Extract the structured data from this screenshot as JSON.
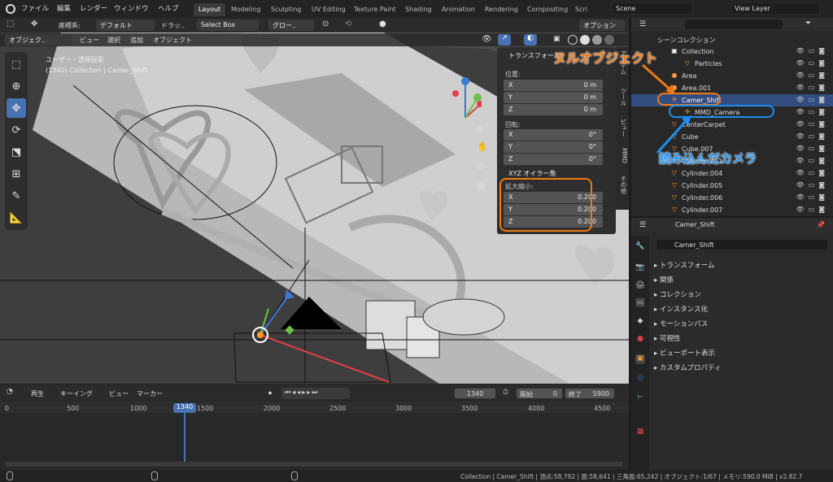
{
  "topbar": {
    "menus": [
      "ファイル",
      "編集",
      "レンダー",
      "ウィンドウ",
      "ヘルプ"
    ],
    "tabs": [
      "Layout",
      "Modeling",
      "Sculpting",
      "UV Editing",
      "Texture Paint",
      "Shading",
      "Animation",
      "Rendering",
      "Compositing",
      "Scri"
    ],
    "scene": "Scene",
    "view_layer": "View Layer"
  },
  "tool_header": {
    "coord_label": "座標系:",
    "coord_value": "デフォルト",
    "drag_label": "ドラッ..",
    "drag_value": "Select Box",
    "transform_pivot": "グロー..",
    "options": "オプション"
  },
  "viewport_header": {
    "mode": "オブジェク..",
    "view": "ビュー",
    "select": "選択",
    "add": "追加",
    "object": "オブジェクト"
  },
  "viewport": {
    "title": "ユーザー・透視投影",
    "subtitle": "(1340) Collection | Camer_Shift"
  },
  "npanel": {
    "title": "トランスフォーム",
    "location_label": "位置:",
    "location": [
      {
        "k": "X",
        "v": "0 m"
      },
      {
        "k": "Y",
        "v": "0 m"
      },
      {
        "k": "Z",
        "v": "0 m"
      }
    ],
    "rotation_label": "回転:",
    "rotation": [
      {
        "k": "X",
        "v": "0°"
      },
      {
        "k": "Y",
        "v": "0°"
      },
      {
        "k": "Z",
        "v": "0°"
      }
    ],
    "rotation_mode": "XYZ オイラー角",
    "scale_label": "拡大縮小:",
    "scale": [
      {
        "k": "X",
        "v": "0.200"
      },
      {
        "k": "Y",
        "v": "0.200"
      },
      {
        "k": "Z",
        "v": "0.200"
      }
    ],
    "tabs": [
      "アイテム",
      "ツール",
      "ビュー",
      "MMD",
      "その他"
    ]
  },
  "outliner": {
    "root": "シーンコレクション",
    "rows": [
      {
        "name": "Collection",
        "icon": "collection"
      },
      {
        "name": "Particles",
        "icon": "mesh"
      },
      {
        "name": "Area",
        "icon": "light"
      },
      {
        "name": "Area.001",
        "icon": "light"
      },
      {
        "name": "Camer_Shift",
        "icon": "empty"
      },
      {
        "name": "MMD_Camera",
        "icon": "camera"
      },
      {
        "name": "CenterCarpet",
        "icon": "mesh"
      },
      {
        "name": "Cube",
        "icon": "mesh"
      },
      {
        "name": "Cube.007",
        "icon": "mesh"
      },
      {
        "name": "Cylinder.001",
        "icon": "mesh"
      },
      {
        "name": "Cylinder.004",
        "icon": "mesh"
      },
      {
        "name": "Cylinder.005",
        "icon": "mesh"
      },
      {
        "name": "Cylinder.006",
        "icon": "mesh"
      },
      {
        "name": "Cylinder.007",
        "icon": "mesh"
      }
    ]
  },
  "properties": {
    "object_name_top": "Camer_Shift",
    "object_name": "Camer_Shift",
    "sections": [
      "トランスフォーム",
      "関係",
      "コレクション",
      "インスタンス化",
      "モーションパス",
      "可視性",
      "ビューポート表示",
      "カスタムプロパティ"
    ]
  },
  "timeline": {
    "playback": "再生",
    "keying": "キーイング",
    "view": "ビュー",
    "marker": "マーカー",
    "current_frame": "1340",
    "start_label": "開始",
    "start": "0",
    "end_label": "終了",
    "end": "5900",
    "ticks": [
      "0",
      "500",
      "1000",
      "1340",
      "1500",
      "2000",
      "2500",
      "3000",
      "3500",
      "4000",
      "4500"
    ]
  },
  "statusbar": {
    "text": "Collection | Camer_Shift | 頂点:58,792 | 面:58,641 | 三角面:65,242 | オブジェクト:1/67 | メモリ:590.0 MiB | v2.82.7"
  },
  "annotations": {
    "null_object": "ヌルオブジェクト",
    "loaded_camera": "読み込んだカメラ"
  },
  "colors": {
    "accent": "#4772b3",
    "annotation_orange": "#f07a12",
    "annotation_blue": "#1c8ff0"
  }
}
